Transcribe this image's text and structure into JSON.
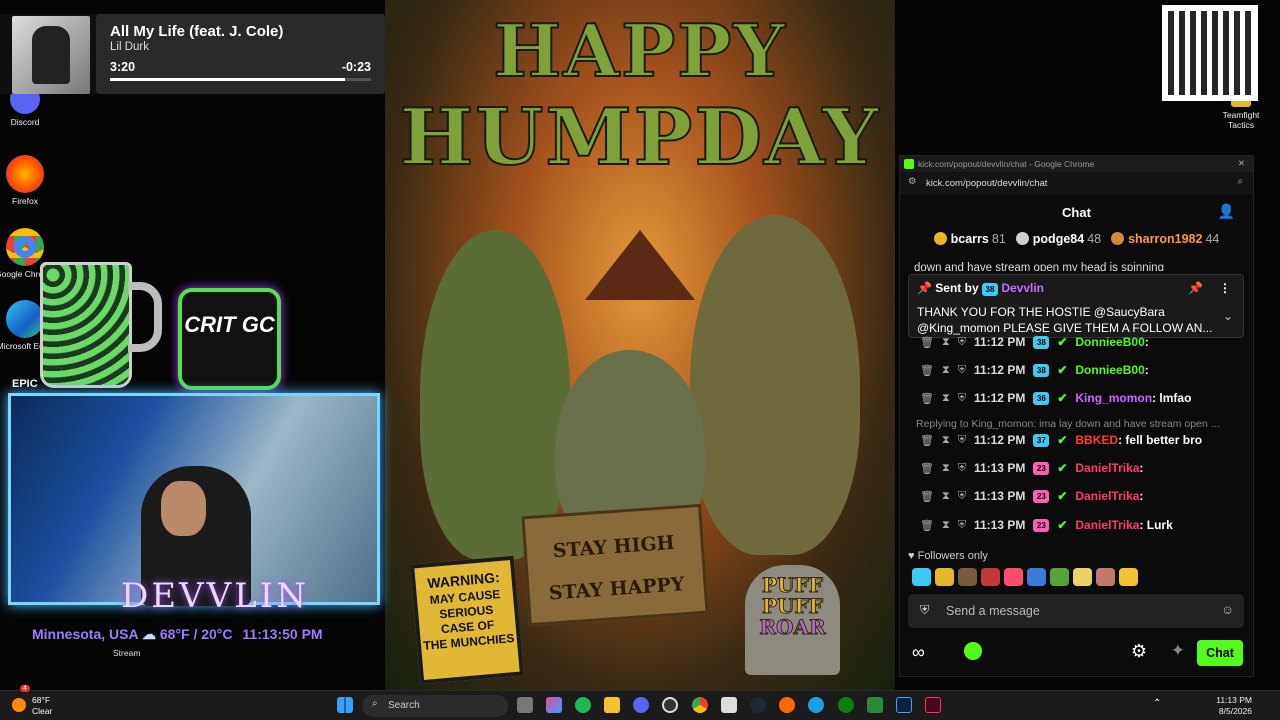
{
  "now_playing": {
    "title": "All My Life (feat. J. Cole)",
    "artist": "Lil Durk",
    "elapsed": "3:20",
    "remaining": "-0:23",
    "progress": 0.9
  },
  "desktop_icons": [
    "Discord",
    "Firefox",
    "Google Chrome",
    "Microsoft Edge",
    "EPIC",
    "Teamfight Tactics",
    "Stream"
  ],
  "poster": {
    "line1": "HAPPY",
    "line2": "HUMPDAY",
    "sign": [
      "STAY HIGH",
      "STAY HAPPY"
    ],
    "warning": [
      "WARNING:",
      "MAY CAUSE",
      "SERIOUS",
      "CASE OF",
      "THE MUNCHIES"
    ],
    "stone": [
      "PUFF",
      "PUFF",
      "ROAR"
    ]
  },
  "crit_logo": "CRIT GC",
  "stream": {
    "overlay_name": "DEVVLIN",
    "location": "Minnesota, USA",
    "weather": "68°F / 20°C",
    "time": "11:13:50 PM"
  },
  "chat": {
    "window_title": "kick.com/popout/devvlin/chat - Google Chrome",
    "url": "kick.com/popout/devvlin/chat",
    "header": "Chat",
    "leaderboard": [
      {
        "name": "bcarrs",
        "count": "81",
        "color": "#e8b52a"
      },
      {
        "name": "podge84",
        "count": "48",
        "color": "#cfcfcf"
      },
      {
        "name": "sharron1982",
        "count": "44",
        "color": "#d08a3a"
      }
    ],
    "partial_line": "down and have stream open my head is spinning",
    "pinned": {
      "sent_by": "Sent by",
      "badge": "38",
      "user": "Devvlin",
      "message": "THANK YOU FOR THE HOSTIE @SaucyBara @King_momon PLEASE GIVE THEM A FOLLOW AN..."
    },
    "messages": [
      {
        "time": "11:12 PM",
        "badge": "38",
        "user": "DonnieeB00",
        "user_color": "#53fc18",
        "text": ":"
      },
      {
        "time": "11:12 PM",
        "badge": "38",
        "user": "DonnieeB00",
        "user_color": "#53fc18",
        "text": ":"
      },
      {
        "time": "11:12 PM",
        "badge": "36",
        "user": "King_momon",
        "user_color": "#c56bff",
        "text": ": lmfao"
      },
      {
        "time": "11:12 PM",
        "badge": "37",
        "user": "BBKED",
        "user_color": "#ff3a3a",
        "text": ": fell better bro"
      },
      {
        "time": "11:13 PM",
        "badge": "23",
        "user": "DanielTrika",
        "user_color": "#ff3a6a",
        "text": ":"
      },
      {
        "time": "11:13 PM",
        "badge": "23",
        "user": "DanielTrika",
        "user_color": "#ff3a6a",
        "text": ":"
      },
      {
        "time": "11:13 PM",
        "badge": "23",
        "user": "DanielTrika",
        "user_color": "#ff3a6a",
        "text": ": Lurk"
      }
    ],
    "reply": "Replying to King_momon: ima lay down and have stream open ...",
    "followers_only": "Followers only",
    "input_placeholder": "Send a message",
    "send_button": "Chat"
  },
  "taskbar": {
    "weather_temp": "68°F",
    "weather_desc": "Clear",
    "search": "Search",
    "time": "11:13 PM",
    "date": "8/5/2026",
    "notif": "4"
  }
}
